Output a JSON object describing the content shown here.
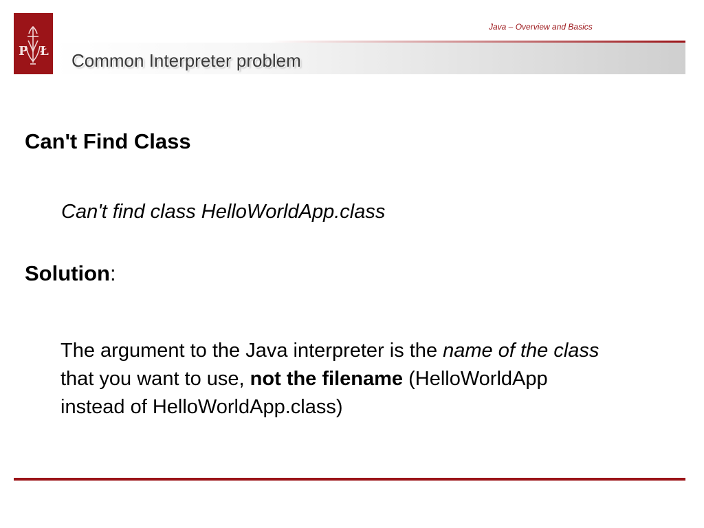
{
  "header": {
    "deck_title": "Java – Overview and Basics",
    "slide_title": "Common Interpreter problem",
    "logo_letters": "P Ł"
  },
  "content": {
    "heading_1": "Can't Find Class",
    "error_message": "Can't find class HelloWorldApp.class",
    "heading_2": "Solution",
    "heading_2_suffix": ":",
    "solution": {
      "line1_plain": "The argument to the Java interpreter is the ",
      "line1_italic": "name of the class",
      "line2_plain": "that you want to use, ",
      "line2_bold": "not the filename",
      "line2_rest": " (HelloWorldApp",
      "line3": "instead of HelloWorldApp.class)"
    }
  },
  "colors": {
    "brand": "#9b1418",
    "title_text": "#3a3a3a",
    "body_text": "#000000"
  }
}
